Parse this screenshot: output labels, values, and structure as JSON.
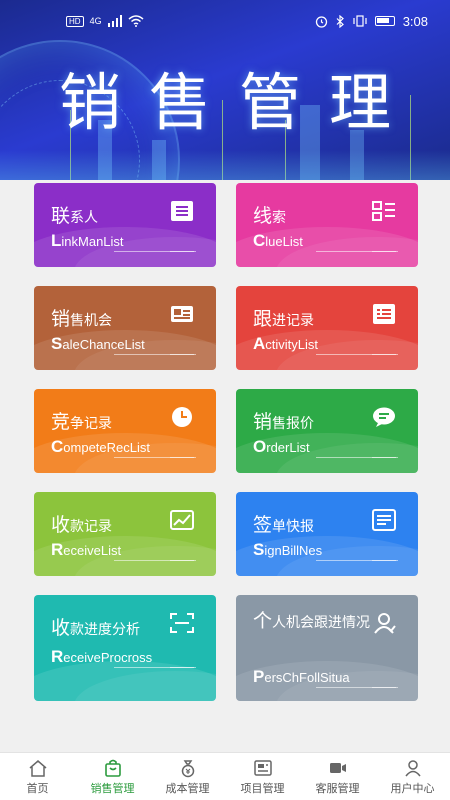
{
  "status": {
    "time": "3:08",
    "network": "4G",
    "hd": "HD"
  },
  "header": {
    "title": "销售管理"
  },
  "cards": [
    {
      "cn_first": "联",
      "cn_rest": "系人",
      "en_first": "L",
      "en_rest": "inkManList",
      "color": "#8b2ec8",
      "icon": "contact-card-icon"
    },
    {
      "cn_first": "线",
      "cn_rest": "索",
      "en_first": "C",
      "en_rest": "lueList",
      "color": "#e63aa0",
      "icon": "list-icon"
    },
    {
      "cn_first": "销",
      "cn_rest": "售机会",
      "en_first": "S",
      "en_rest": "aleChanceList",
      "color": "#b3623a",
      "icon": "id-card-icon"
    },
    {
      "cn_first": "跟",
      "cn_rest": "进记录",
      "en_first": "A",
      "en_rest": "ctivityList",
      "color": "#e4443d",
      "icon": "record-icon"
    },
    {
      "cn_first": "竞",
      "cn_rest": "争记录",
      "en_first": "C",
      "en_rest": "ompeteRecList",
      "color": "#f27c18",
      "icon": "clock-icon"
    },
    {
      "cn_first": "销",
      "cn_rest": "售报价",
      "en_first": "O",
      "en_rest": "rderList",
      "color": "#2daa47",
      "icon": "chat-bubble-icon"
    },
    {
      "cn_first": "收",
      "cn_rest": "款记录",
      "en_first": "R",
      "en_rest": "eceiveList",
      "color": "#8cc43c",
      "icon": "chart-image-icon"
    },
    {
      "cn_first": "签",
      "cn_rest": "单快报",
      "en_first": "S",
      "en_rest": "ignBillNes",
      "color": "#2d82f0",
      "icon": "form-icon"
    },
    {
      "cn_first": "收",
      "cn_rest": "款进度分析",
      "en_first": "R",
      "en_rest": "eceiveProcross",
      "color": "#1fbab0",
      "icon": "scan-icon"
    },
    {
      "cn_first": "个",
      "cn_rest": "人机会跟进情况",
      "en_first": "P",
      "en_rest": "ersChFollSitua",
      "color": "#8a98a6",
      "icon": "person-icon"
    }
  ],
  "nav": [
    {
      "label": "首页",
      "icon": "home-icon",
      "active": false
    },
    {
      "label": "销售管理",
      "icon": "shopping-bag-icon",
      "active": true
    },
    {
      "label": "成本管理",
      "icon": "money-bag-icon",
      "active": false
    },
    {
      "label": "项目管理",
      "icon": "project-icon",
      "active": false
    },
    {
      "label": "客服管理",
      "icon": "video-icon",
      "active": false
    },
    {
      "label": "用户中心",
      "icon": "user-icon",
      "active": false
    }
  ]
}
